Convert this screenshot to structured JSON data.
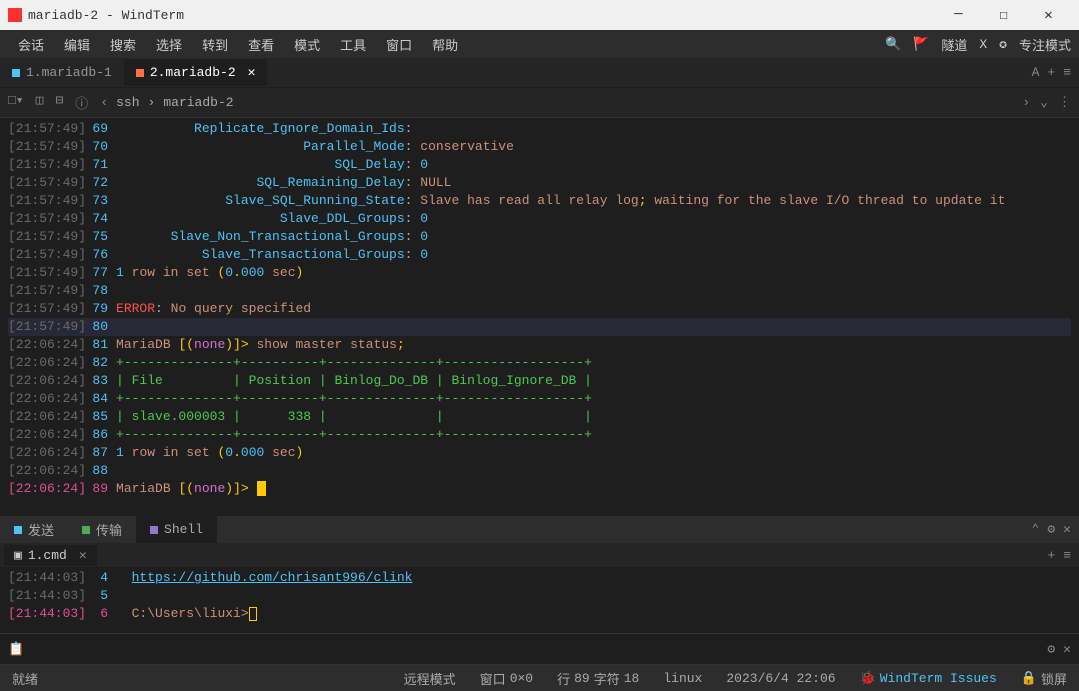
{
  "window": {
    "title": "mariadb-2 - WindTerm"
  },
  "menu": {
    "session": "会话",
    "edit": "编辑",
    "search": "搜索",
    "select": "选择",
    "goto": "转到",
    "view": "查看",
    "mode": "模式",
    "tool": "工具",
    "window": "窗口",
    "help": "帮助",
    "tunnel_icon": "🚩",
    "tunnel": "隧道",
    "x": "X",
    "focus_icon": "✪",
    "focus": "专注模式"
  },
  "tabs": {
    "t1": "1.mariadb-1",
    "t2": "2.mariadb-2",
    "font": "A",
    "plus": "+",
    "menu": "≡"
  },
  "toolbar": {
    "breadcrumb_sep": "›",
    "bc1": "ssh",
    "bc2": "mariadb-2"
  },
  "term": {
    "ts1": "[21:57:49]",
    "ts2": "[22:06:24]",
    "l69": "          Replicate_Ignore_Domain_Ids",
    "l70": "                        Parallel_Mode",
    "l70v": "conservative",
    "l71": "                            SQL_Delay",
    "l72": "                  SQL_Remaining_Delay",
    "l73": "              Slave_SQL_Running_State",
    "l73v": "Slave has read all relay log",
    "l73v2": "waiting for the slave I/O thread to update it",
    "l74": "                     Slave_DDL_Groups",
    "l75": "       Slave_Non_Transactional_Groups",
    "l76": "           Slave_Transactional_Groups",
    "l77a": "1",
    "l77b": "row in set",
    "l77c": "0",
    "l77d": "000",
    "l77e": "sec",
    "l79a": "ERROR",
    "l79b": "No query specified",
    "l81a": "MariaDB",
    "l81b": "none",
    "l81c": "show master status",
    "sep1": "+--------------+----------+--------------+------------------+",
    "hdr": "| File         | Position | Binlog_Do_DB | Binlog_Ignore_DB |",
    "row": "| slave.000003 |      338 |              |                  |",
    "l88a": "1",
    "l88b": "row in set",
    "l88c": "0",
    "l88d": "000",
    "l88e": "sec",
    "null": "NULL",
    "zero": "0",
    "colon": ": ",
    "semi": "; ",
    "semi2": ";"
  },
  "bottom_tabs": {
    "send": "发送",
    "transfer": "传输",
    "shell": "Shell"
  },
  "cmd": {
    "tab": "1.cmd",
    "ts": "[21:44:03]",
    "link": "https://github.com/chrisant996/clink",
    "path": "C:\\Users\\liuxi>",
    "plus": "+",
    "menu": "≡"
  },
  "status": {
    "ready": "就绪",
    "remote": "远程模式",
    "viewport_l": "窗口",
    "viewport": "0×0",
    "line_l": "行",
    "line": "89",
    "char_l": "字符",
    "char": "18",
    "os": "linux",
    "datetime": "2023/6/4 22:06",
    "issues": "WindTerm Issues",
    "lock": "锁屏"
  }
}
